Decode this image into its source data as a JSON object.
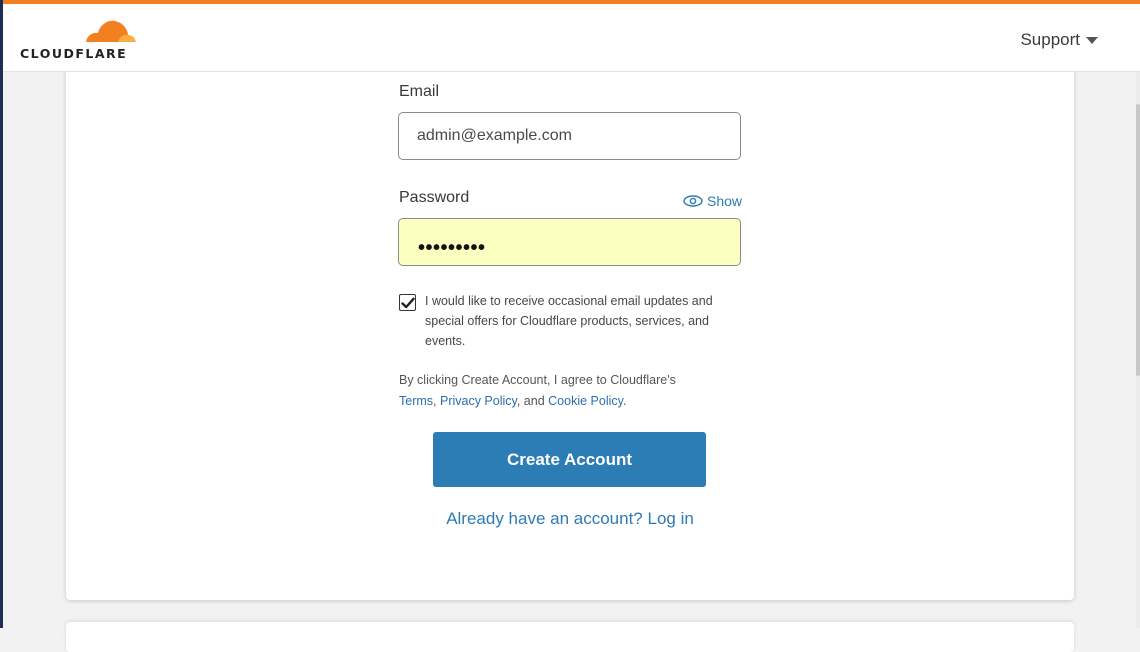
{
  "header": {
    "logo_text": "CLOUDFLARE",
    "support_label": "Support",
    "accent_color": "#f38020"
  },
  "form": {
    "email_label": "Email",
    "email_value": "admin@example.com",
    "password_label": "Password",
    "password_masked": "•••••••••",
    "show_label": "Show",
    "consent_checked": true,
    "consent_text": "I would like to receive occasional email updates and special offers for Cloudflare products, services, and events.",
    "terms_prefix": "By clicking Create Account, I agree to Cloudflare's",
    "terms_link": "Terms",
    "terms_sep1": ", ",
    "privacy_link": "Privacy Policy",
    "terms_sep2": ", and ",
    "cookie_link": "Cookie Policy",
    "terms_suffix": ".",
    "submit_label": "Create Account",
    "login_link": "Already have an account? Log in",
    "button_color": "#2c7cb5",
    "autofill_color": "#fbffbf"
  }
}
